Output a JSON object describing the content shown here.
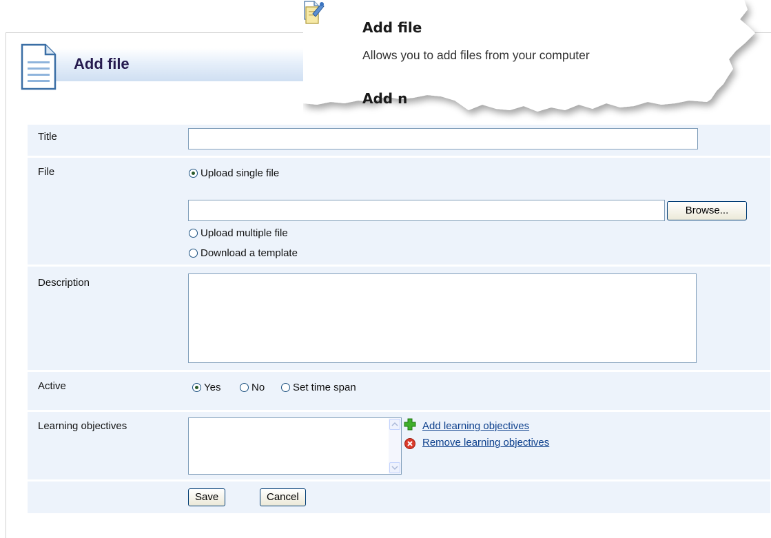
{
  "page": {
    "title": "Add file"
  },
  "callout": {
    "title": "Add file",
    "description": "Allows you to add files from your computer",
    "next_item": "Add n"
  },
  "form": {
    "title": {
      "label": "Title",
      "value": ""
    },
    "file": {
      "label": "File",
      "option_single": "Upload single file",
      "option_multiple": "Upload multiple file",
      "option_template": "Download a template",
      "selected": "Upload single file",
      "path_value": "",
      "browse_label": "Browse..."
    },
    "description": {
      "label": "Description",
      "value": ""
    },
    "active": {
      "label": "Active",
      "option_yes": "Yes",
      "option_no": "No",
      "option_timespan": "Set time span",
      "selected": "Yes"
    },
    "learning_objectives": {
      "label": "Learning objectives",
      "add_link": "Add learning objectives",
      "remove_link": "Remove learning objectives"
    },
    "actions": {
      "save_label": "Save",
      "cancel_label": "Cancel"
    }
  },
  "icons": {
    "header": "document-icon",
    "callout": "document-icon",
    "callout_next": "page-edit-icon",
    "add": "plus-icon",
    "remove": "delete-circle-icon"
  },
  "colors": {
    "row_background": "#edf3fb",
    "title_color": "#251a4e",
    "link_color": "#0c3f8c",
    "header_gradient": "#cfdff2"
  }
}
